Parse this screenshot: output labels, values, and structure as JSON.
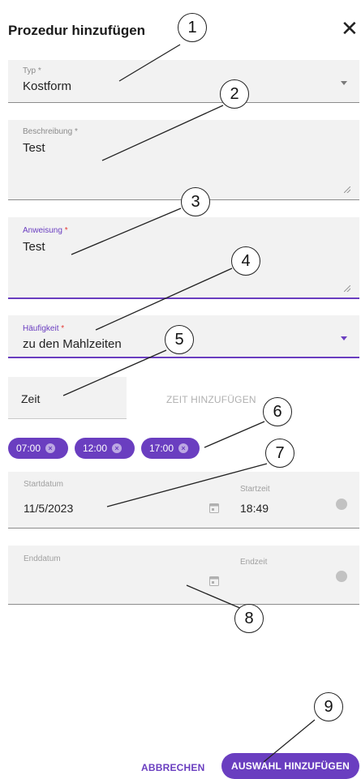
{
  "dialog": {
    "title": "Prozedur hinzufügen",
    "close_glyph": "✕"
  },
  "type_field": {
    "label": "Typ",
    "required_mark": "*",
    "value": "Kostform"
  },
  "description_field": {
    "label": "Beschreibung",
    "required_mark": "*",
    "value": "Test"
  },
  "instruction_field": {
    "label": "Anweisung",
    "required_mark": "*",
    "value": "Test"
  },
  "frequency_field": {
    "label": "Häufigkeit",
    "required_mark": "*",
    "value": "zu den Mahlzeiten"
  },
  "time_section": {
    "tab_label": "Zeit",
    "add_time_label": "ZEIT HINZUFÜGEN",
    "chips": [
      "07:00",
      "12:00",
      "17:00"
    ],
    "chip_remove_glyph": "×"
  },
  "start": {
    "date_label": "Startdatum",
    "date_value": "11/5/2023",
    "time_label": "Startzeit",
    "time_value": "18:49"
  },
  "end": {
    "date_label": "Enddatum",
    "date_value": "",
    "time_label": "Endzeit",
    "time_value": ""
  },
  "footer": {
    "cancel_label": "ABBRECHEN",
    "confirm_label": "AUSWAHL HINZUFÜGEN"
  },
  "callouts": [
    "1",
    "2",
    "3",
    "4",
    "5",
    "6",
    "7",
    "8",
    "9"
  ],
  "colors": {
    "accent": "#6a3ec0",
    "required": "#e53935",
    "field_background": "#f2f2f2"
  }
}
